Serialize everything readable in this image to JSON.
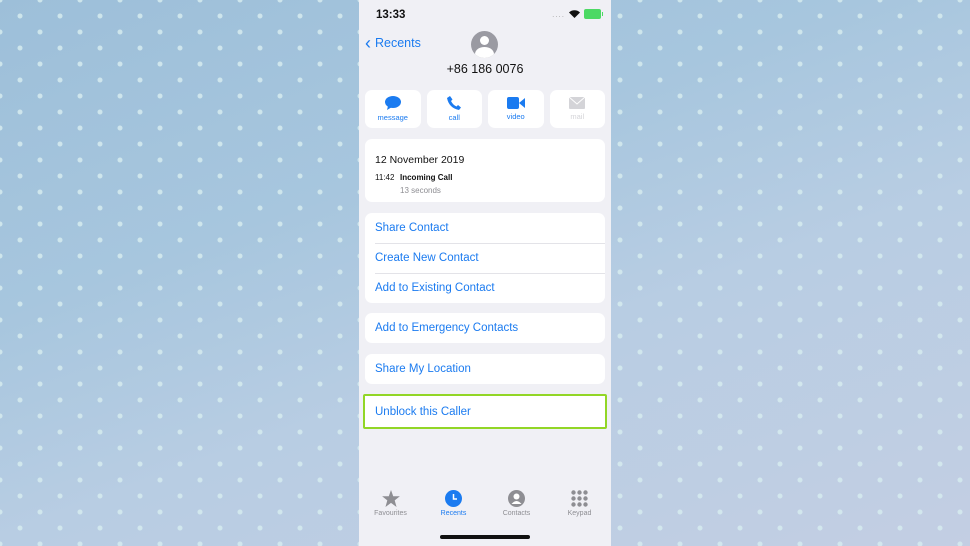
{
  "status_bar": {
    "time": "13:33",
    "signal": "....",
    "battery_color": "#4cd964"
  },
  "nav": {
    "back_label": "Recents"
  },
  "contact": {
    "number": "+86 186 0076"
  },
  "actions": [
    {
      "label": "message",
      "icon": "message-icon",
      "enabled": true
    },
    {
      "label": "call",
      "icon": "phone-icon",
      "enabled": true
    },
    {
      "label": "video",
      "icon": "video-icon",
      "enabled": true
    },
    {
      "label": "mail",
      "icon": "mail-icon",
      "enabled": false
    }
  ],
  "call_log": {
    "date": "12 November 2019",
    "time": "11:42",
    "type": "Incoming Call",
    "duration": "13 seconds"
  },
  "menu_groups": [
    [
      "Share Contact",
      "Create New Contact",
      "Add to Existing Contact"
    ],
    [
      "Add to Emergency Contacts"
    ],
    [
      "Share My Location"
    ],
    [
      "Unblock this Caller"
    ]
  ],
  "tabs": [
    {
      "label": "Favourites",
      "icon": "star-icon",
      "active": false
    },
    {
      "label": "Recents",
      "icon": "clock-icon",
      "active": true
    },
    {
      "label": "Contacts",
      "icon": "person-circle-icon",
      "active": false
    },
    {
      "label": "Keypad",
      "icon": "keypad-icon",
      "active": false
    }
  ],
  "colors": {
    "accent": "#1b7bf0",
    "highlight": "#92d626",
    "background": "#f0f0f5"
  }
}
